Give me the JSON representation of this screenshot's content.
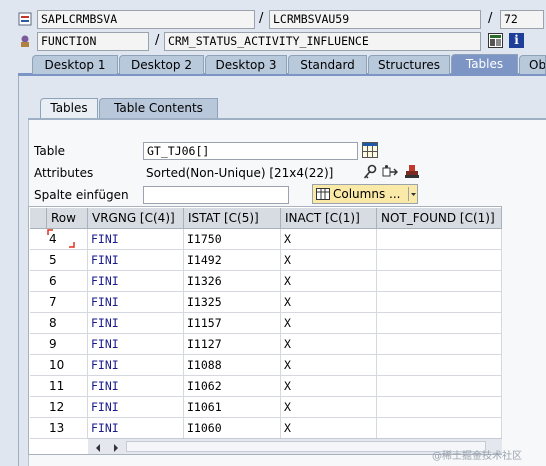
{
  "header": {
    "program": "SAPLCRMBSVA",
    "include": "LCRMBSVAU59",
    "line": "72",
    "type": "FUNCTION",
    "name": "CRM_STATUS_ACTIVITY_INFLUENCE",
    "separator": "/"
  },
  "tabs": [
    "Desktop 1",
    "Desktop 2",
    "Desktop 3",
    "Standard",
    "Structures",
    "Tables",
    "Obj"
  ],
  "active_tab": "Tables",
  "subtabs": [
    "Tables",
    "Table Contents"
  ],
  "active_subtab": "Table Contents",
  "form": {
    "table_label": "Table",
    "table_value": "GT_TJ06[]",
    "attributes_label": "Attributes",
    "attributes_value": "Sorted(Non-Unique) [21x4(22)]",
    "spalte_label": "Spalte einfügen",
    "spalte_value": "",
    "columns_button": "Columns ..."
  },
  "grid": {
    "columns": [
      "Row",
      "VRGNG [C(4)]",
      "ISTAT [C(5)]",
      "INACT [C(1)]",
      "NOT_FOUND [C(1)]"
    ],
    "rows": [
      {
        "row": "4",
        "vrgng": "FINI",
        "istat": "I1750",
        "inact": "X",
        "not_found": ""
      },
      {
        "row": "5",
        "vrgng": "FINI",
        "istat": "I1492",
        "inact": "X",
        "not_found": ""
      },
      {
        "row": "6",
        "vrgng": "FINI",
        "istat": "I1326",
        "inact": "X",
        "not_found": ""
      },
      {
        "row": "7",
        "vrgng": "FINI",
        "istat": "I1325",
        "inact": "X",
        "not_found": ""
      },
      {
        "row": "8",
        "vrgng": "FINI",
        "istat": "I1157",
        "inact": "X",
        "not_found": ""
      },
      {
        "row": "9",
        "vrgng": "FINI",
        "istat": "I1127",
        "inact": "X",
        "not_found": ""
      },
      {
        "row": "10",
        "vrgng": "FINI",
        "istat": "I1088",
        "inact": "X",
        "not_found": ""
      },
      {
        "row": "11",
        "vrgng": "FINI",
        "istat": "I1062",
        "inact": "X",
        "not_found": ""
      },
      {
        "row": "12",
        "vrgng": "FINI",
        "istat": "I1061",
        "inact": "X",
        "not_found": ""
      },
      {
        "row": "13",
        "vrgng": "FINI",
        "istat": "I1060",
        "inact": "X",
        "not_found": ""
      }
    ]
  },
  "watermark": "@稀土掘金技术社区",
  "colors": {
    "active_tab": "#7c95c4",
    "tab": "#b9c9dc",
    "cell_value_blue": "#1a1a8c",
    "selection_red": "#e0301e"
  },
  "icons": [
    "program-icon",
    "function-icon",
    "table-layout-icon",
    "key-icon",
    "navigate-icon",
    "stamp-icon",
    "info-icon",
    "grid-icon",
    "dropdown-icon",
    "scroll-left-icon",
    "scroll-right-icon"
  ]
}
